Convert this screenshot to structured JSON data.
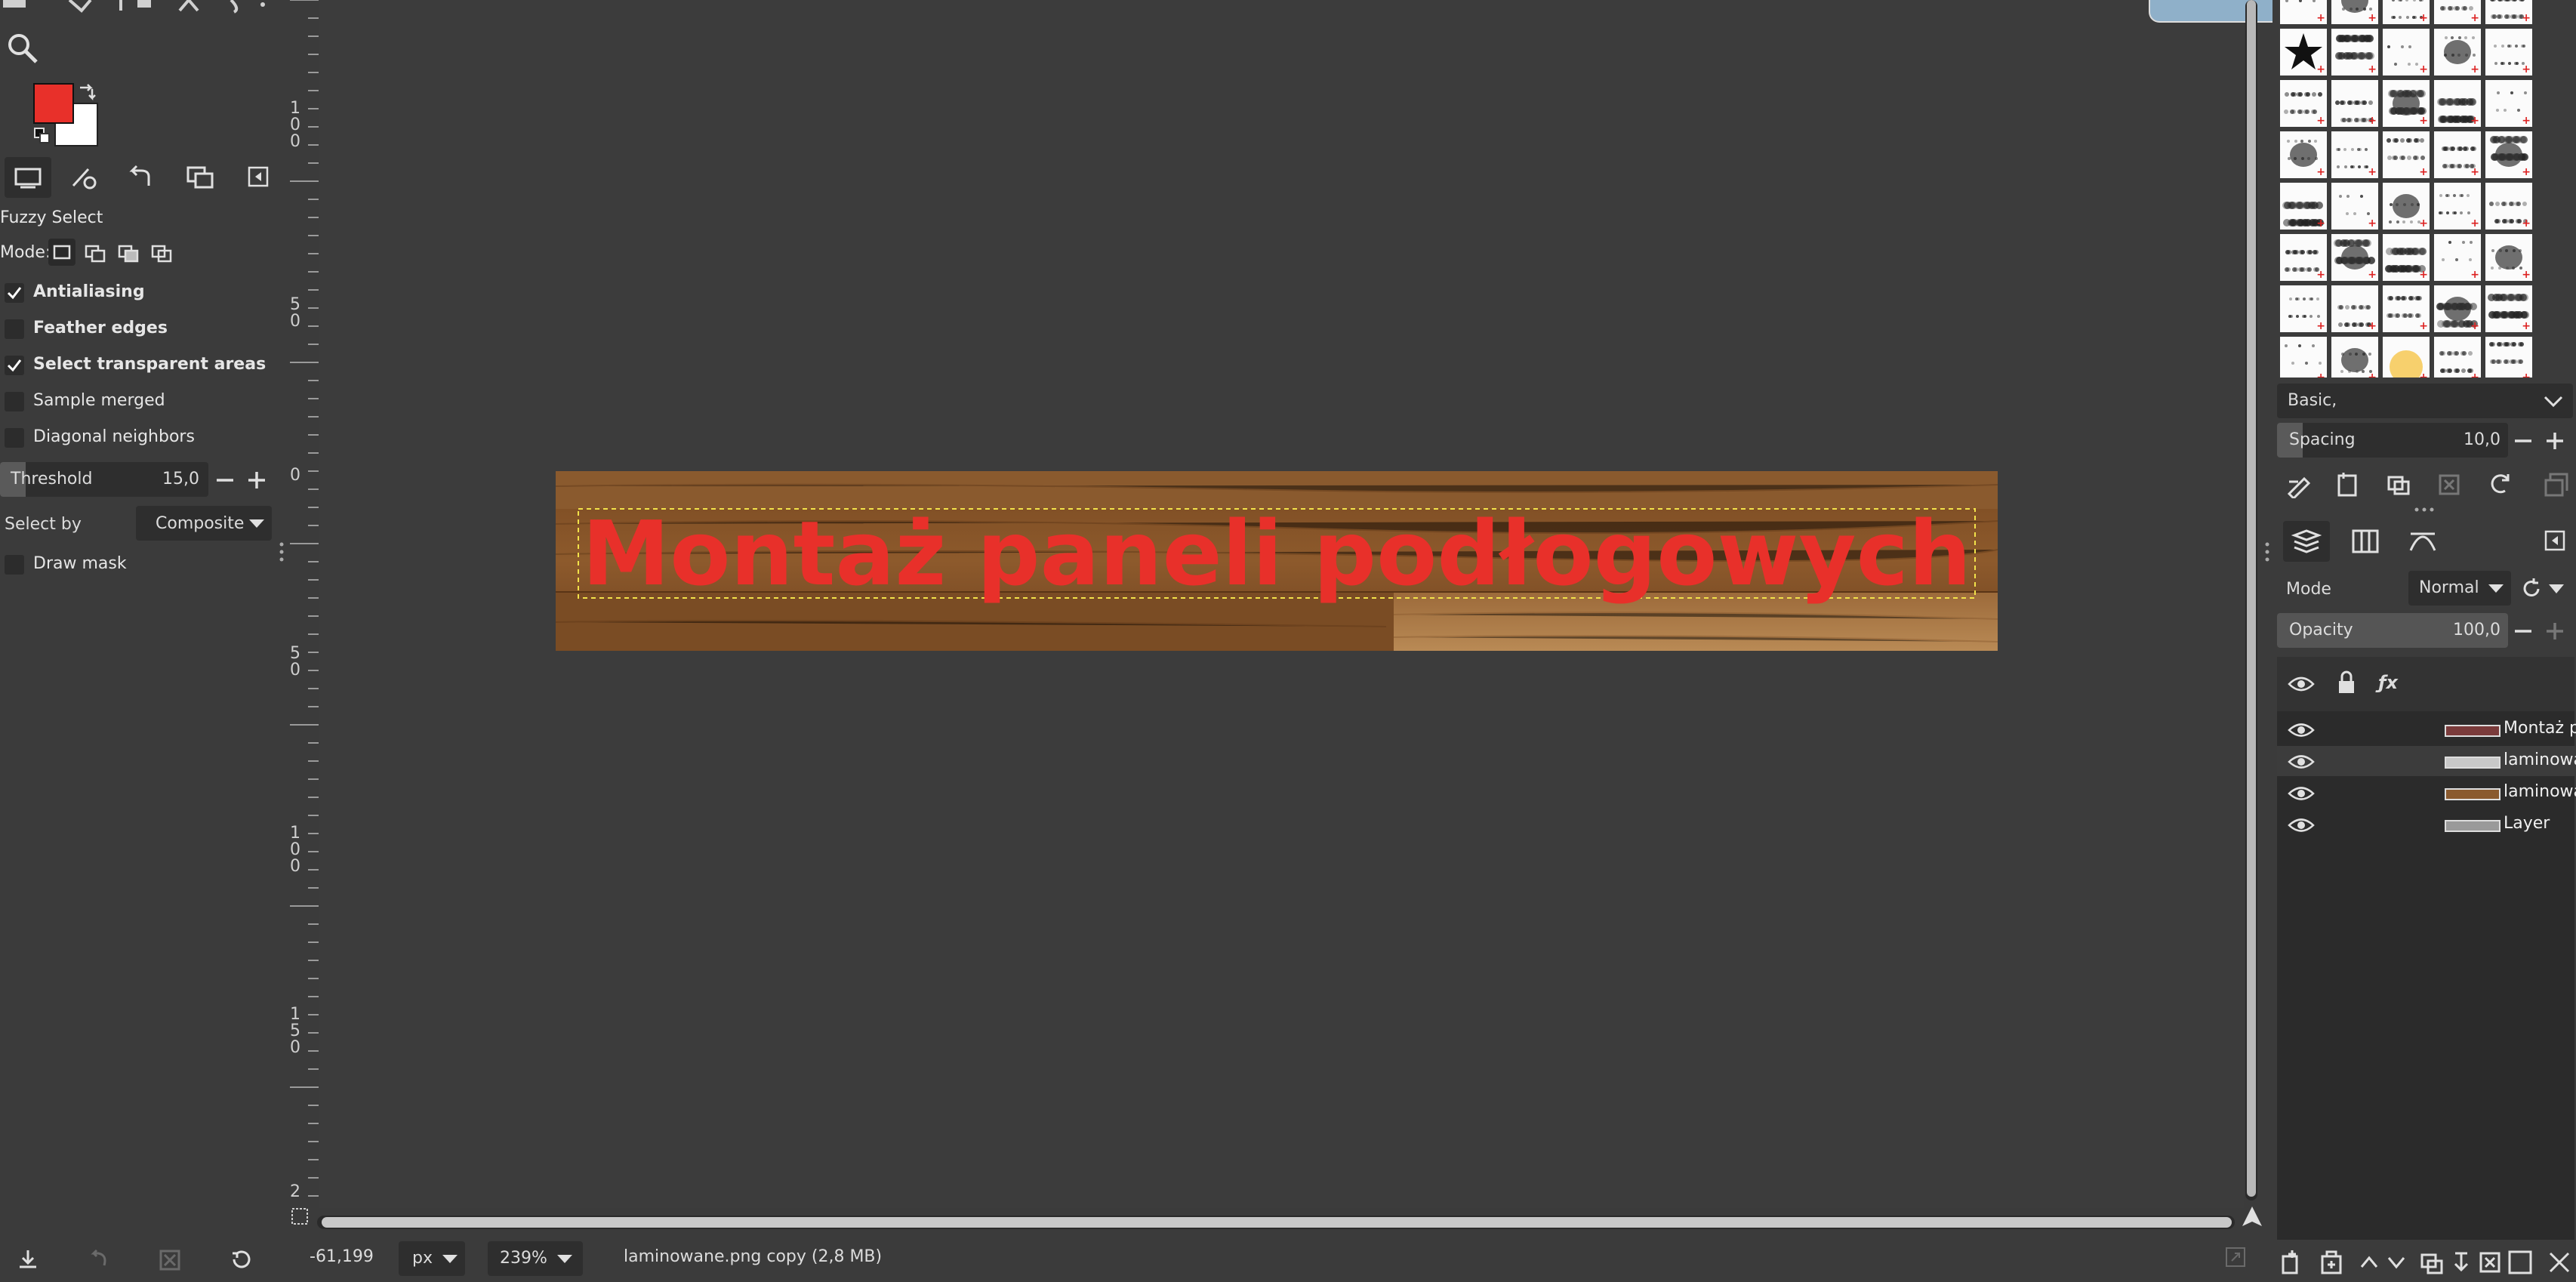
{
  "tool_options": {
    "tool_name": "Fuzzy Select",
    "mode_label": "Mode:",
    "options": [
      {
        "label": "Antialiasing",
        "checked": true,
        "bold": true
      },
      {
        "label": "Feather edges",
        "checked": false,
        "bold": true
      },
      {
        "label": "Select transparent areas",
        "checked": true,
        "bold": true
      },
      {
        "label": "Sample merged",
        "checked": false,
        "bold": false
      },
      {
        "label": "Diagonal neighbors",
        "checked": false,
        "bold": false
      }
    ],
    "threshold_label": "Threshold",
    "threshold_value": "15,0",
    "select_by_label": "Select by",
    "select_by_value": "Composite",
    "draw_mask_label": "Draw mask",
    "draw_mask_checked": false
  },
  "colors": {
    "foreground": "#e8302a",
    "background": "#ffffff",
    "text_fill": "#e8302a"
  },
  "canvas": {
    "image_text": "Montaż paneli podłogowych",
    "ruler_labels": [
      "1\n0\n0",
      "5\n0",
      "0",
      "5\n0",
      "1\n0\n0",
      "1\n5\n0",
      "2"
    ]
  },
  "status": {
    "coords": "-61,199",
    "unit": "px",
    "zoom": "239%",
    "file_info": "laminowane.png copy (2,8 MB)"
  },
  "brushes": {
    "preset_label": "Basic,",
    "spacing_label": "Spacing",
    "spacing_value": "10,0"
  },
  "layers": {
    "mode_label": "Mode",
    "mode_value": "Normal",
    "opacity_label": "Opacity",
    "opacity_value": "100,0",
    "items": [
      {
        "name": "Montaż p"
      },
      {
        "name": "laminowa"
      },
      {
        "name": "laminowa"
      },
      {
        "name": "Layer"
      }
    ]
  },
  "icons": [
    "search-icon",
    "swap-colors-icon",
    "tool-options-tab-icon",
    "device-status-tab-icon",
    "undo-history-tab-icon",
    "images-tab-icon",
    "dock-menu-icon",
    "layers-tab-icon",
    "channels-tab-icon",
    "paths-tab-icon",
    "eye-icon",
    "lock-icon",
    "fx-icon"
  ]
}
